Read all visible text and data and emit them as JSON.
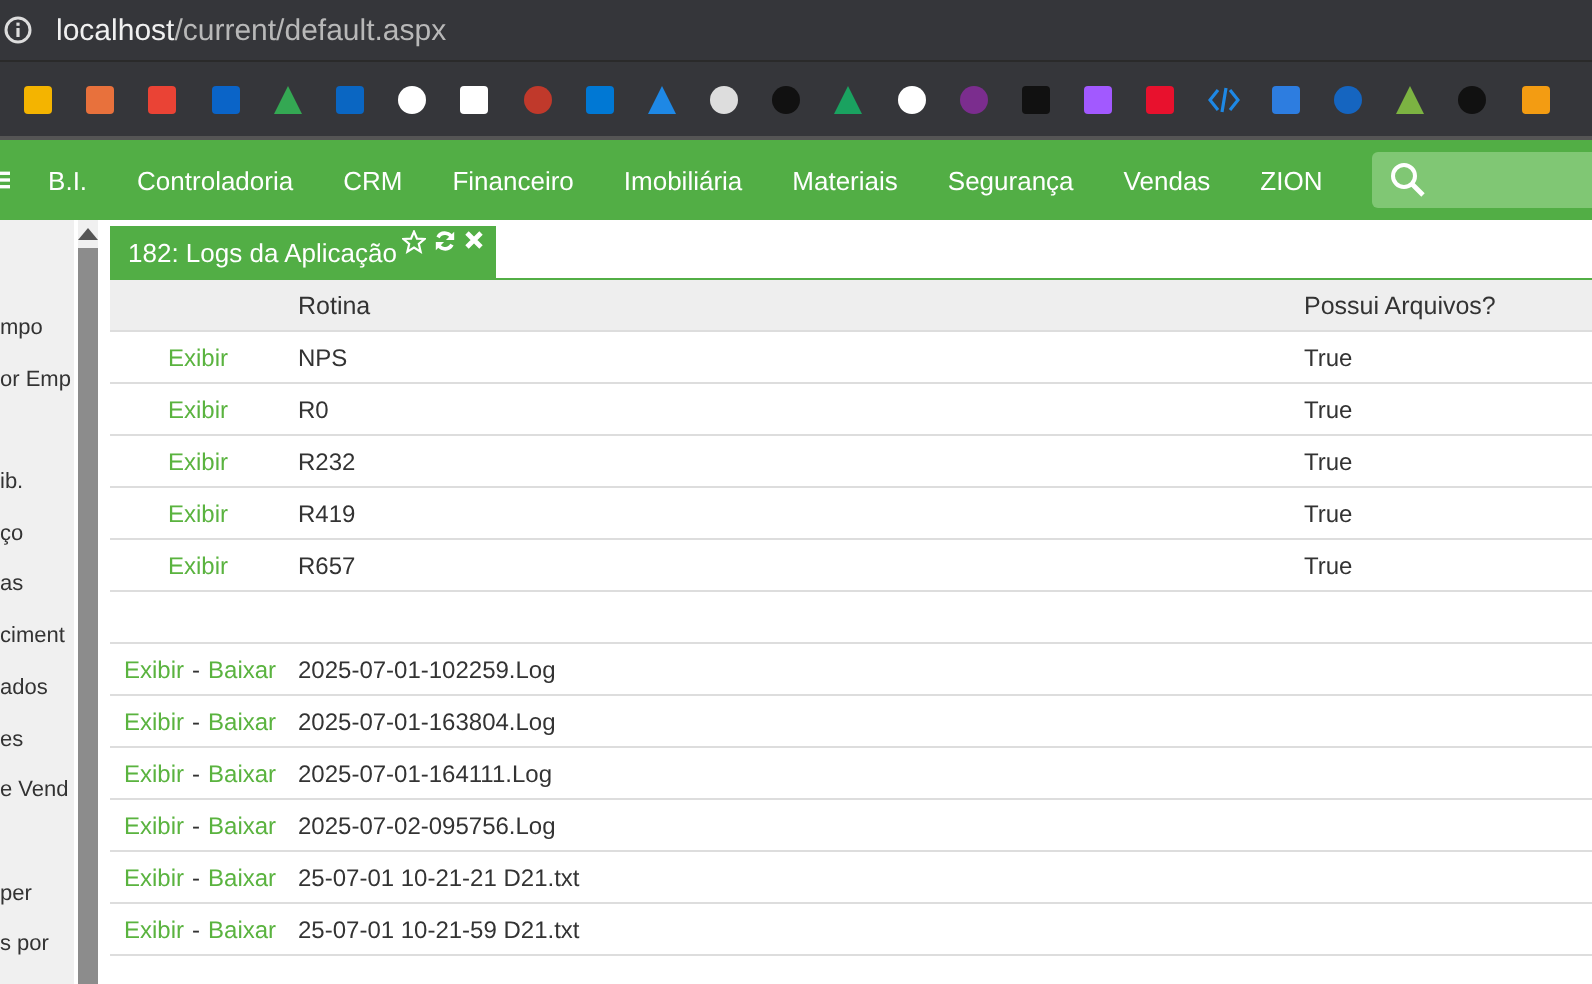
{
  "address_bar": {
    "host": "localhost",
    "path": "/current/default.aspx"
  },
  "nav": {
    "items": [
      "B.I.",
      "Controladoria",
      "CRM",
      "Financeiro",
      "Imobiliária",
      "Materiais",
      "Segurança",
      "Vendas",
      "ZION"
    ]
  },
  "sidebar": {
    "items": [
      {
        "label": "mpo"
      },
      {
        "label": "or Emp"
      },
      {
        "label": "ib.",
        "gap_before": true
      },
      {
        "label": "ço"
      },
      {
        "label": "as"
      },
      {
        "label": "ciment"
      },
      {
        "label": "ados"
      },
      {
        "label": "es"
      },
      {
        "label": "e Vend"
      },
      {
        "label": "per",
        "gap_before": true
      },
      {
        "label": "s por"
      }
    ]
  },
  "tab": {
    "title": "182: Logs da Aplicação",
    "selected": true
  },
  "routines": {
    "columns": [
      "Rotina",
      "Possui Arquivos?"
    ],
    "rows": [
      {
        "action": "Exibir",
        "rotina": "NPS",
        "possui": "True"
      },
      {
        "action": "Exibir",
        "rotina": "R0",
        "possui": "True"
      },
      {
        "action": "Exibir",
        "rotina": "R232",
        "possui": "True"
      },
      {
        "action": "Exibir",
        "rotina": "R419",
        "possui": "True"
      },
      {
        "action": "Exibir",
        "rotina": "R657",
        "possui": "True"
      }
    ]
  },
  "files": {
    "rows": [
      {
        "view": "Exibir",
        "separator": "-",
        "download": "Baixar",
        "name": "2025-07-01-102259.Log"
      },
      {
        "view": "Exibir",
        "separator": "-",
        "download": "Baixar",
        "name": "2025-07-01-163804.Log"
      },
      {
        "view": "Exibir",
        "separator": "-",
        "download": "Baixar",
        "name": "2025-07-01-164111.Log"
      },
      {
        "view": "Exibir",
        "separator": "-",
        "download": "Baixar",
        "name": "2025-07-02-095756.Log"
      },
      {
        "view": "Exibir",
        "separator": "-",
        "download": "Baixar",
        "name": "25-07-01 10-21-21 D21.txt"
      },
      {
        "view": "Exibir",
        "separator": "-",
        "download": "Baixar",
        "name": "25-07-01 10-21-59 D21.txt"
      }
    ]
  }
}
